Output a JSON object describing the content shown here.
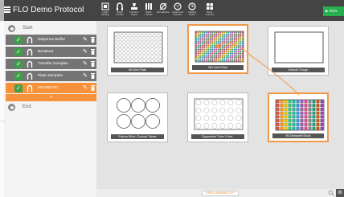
{
  "header": {
    "title": "FLO Demo Protocol",
    "toolbar": [
      {
        "label": "Liquid Handling",
        "icon": "liquid-handling-icon"
      },
      {
        "label": "Single Transfer",
        "icon": "single-transfer-icon"
      },
      {
        "label": "Combine / Aliquot",
        "icon": "combine-aliquot-icon"
      },
      {
        "label": "Batch Transfer",
        "icon": "batch-transfer-icon"
      },
      {
        "label": "Normalization",
        "icon": "normalization-icon"
      },
      {
        "label": "Liquid Level Detection",
        "icon": "liquid-level-icon"
      },
      {
        "label": "Labelling Station",
        "icon": "timer-icon"
      },
      {
        "label": "Batch Selection",
        "icon": "batch-selection-icon"
      }
    ],
    "run_label": "RUN",
    "accent": "#27ae4f"
  },
  "sidebar": {
    "start_label": "Start",
    "end_label": "End",
    "steps": [
      {
        "label": "Dispense Buffer",
        "active": false
      },
      {
        "label": "Breakout",
        "active": false
      },
      {
        "label": "Transfer Samples",
        "active": false
      },
      {
        "label": "Plate Samples",
        "active": false
      },
      {
        "label": "MAGNETIC",
        "active": true
      }
    ],
    "expand_glyph": "▾",
    "accent": "#f7923a",
    "check_color": "#3f9e48"
  },
  "deck": {
    "slots": [
      {
        "label": "96 Well Plate",
        "kind": "96",
        "selected": false
      },
      {
        "label": "384 Well Plate",
        "kind": "384",
        "selected": true
      },
      {
        "label": "Default Trough",
        "kind": "trough",
        "selected": false
      },
      {
        "label": "Falcon 50mL Conical Tubes",
        "kind": "tubes-large",
        "selected": false
      },
      {
        "label": "Eppendorf Tube 1.5mL",
        "kind": "tubes-small",
        "selected": false
      },
      {
        "label": "96 Deepwell Block",
        "kind": "deepwell",
        "selected": true
      }
    ],
    "open_library_label": "OPEN LABWARE LIST",
    "arrow_color": "#f7923a"
  }
}
